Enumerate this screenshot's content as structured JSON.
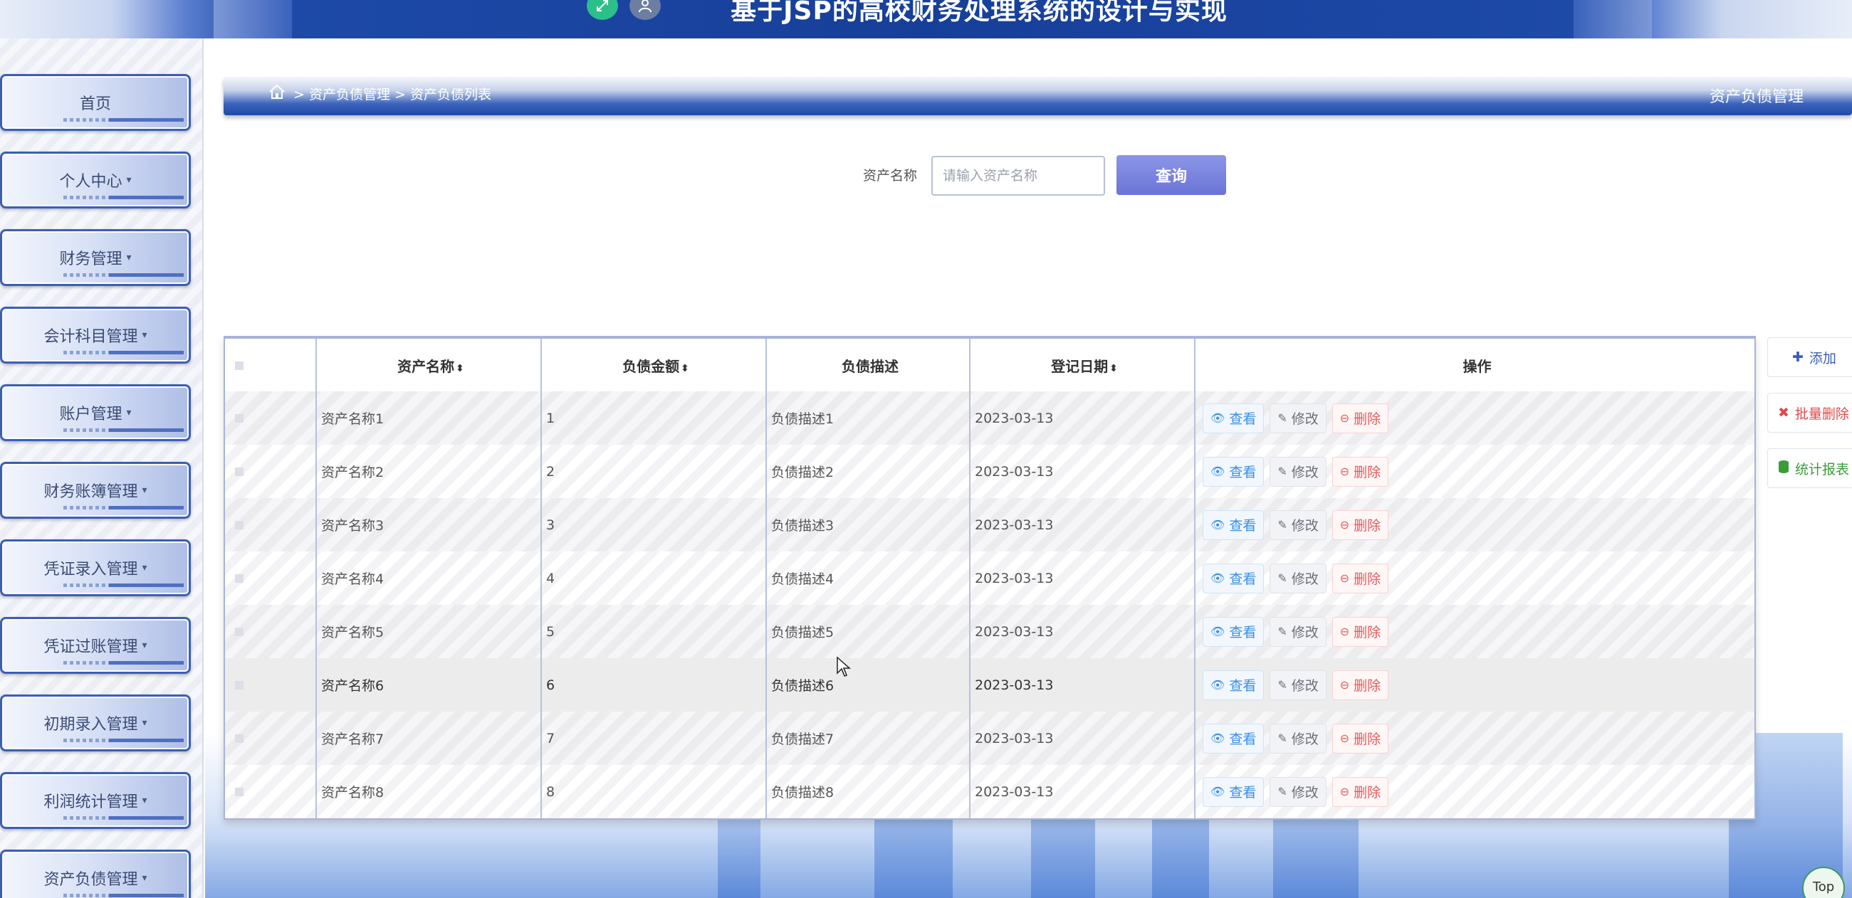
{
  "header": {
    "title": "基于JSP的高校财务处理系统的设计与实现"
  },
  "sidebar": {
    "items": [
      {
        "label": "首页",
        "has_caret": false
      },
      {
        "label": "个人中心",
        "has_caret": true
      },
      {
        "label": "财务管理",
        "has_caret": true
      },
      {
        "label": "会计科目管理",
        "has_caret": true
      },
      {
        "label": "账户管理",
        "has_caret": true
      },
      {
        "label": "财务账簿管理",
        "has_caret": true
      },
      {
        "label": "凭证录入管理",
        "has_caret": true
      },
      {
        "label": "凭证过账管理",
        "has_caret": true
      },
      {
        "label": "初期录入管理",
        "has_caret": true
      },
      {
        "label": "利润统计管理",
        "has_caret": true
      },
      {
        "label": "资产负债管理",
        "has_caret": true
      }
    ]
  },
  "breadcrumb": {
    "separator": ">",
    "level1": "资产负债管理",
    "level2": "资产负债列表",
    "right_title": "资产负债管理"
  },
  "search": {
    "label": "资产名称",
    "placeholder": "请输入资产名称",
    "value": "",
    "button_label": "查询"
  },
  "table": {
    "columns": [
      "资产名称",
      "负债金额",
      "负债描述",
      "登记日期",
      "操作"
    ],
    "sort_icon": "sort-icon",
    "rows": [
      {
        "name": "资产名称1",
        "amount": "1",
        "desc": "负债描述1",
        "date": "2023-03-13"
      },
      {
        "name": "资产名称2",
        "amount": "2",
        "desc": "负债描述2",
        "date": "2023-03-13"
      },
      {
        "name": "资产名称3",
        "amount": "3",
        "desc": "负债描述3",
        "date": "2023-03-13"
      },
      {
        "name": "资产名称4",
        "amount": "4",
        "desc": "负债描述4",
        "date": "2023-03-13"
      },
      {
        "name": "资产名称5",
        "amount": "5",
        "desc": "负债描述5",
        "date": "2023-03-13"
      },
      {
        "name": "资产名称6",
        "amount": "6",
        "desc": "负债描述6",
        "date": "2023-03-13"
      },
      {
        "name": "资产名称7",
        "amount": "7",
        "desc": "负债描述7",
        "date": "2023-03-13"
      },
      {
        "name": "资产名称8",
        "amount": "8",
        "desc": "负债描述8",
        "date": "2023-03-13"
      }
    ],
    "actions": {
      "view": "查看",
      "edit": "修改",
      "delete": "删除"
    }
  },
  "side_actions": {
    "add": "添加",
    "batch_delete": "批量删除",
    "report": "统计报表"
  },
  "top_button": "Top",
  "colors": {
    "brand": "#1e4aa8",
    "search_button": "#6a74d6",
    "view": "#3a8ee6",
    "delete": "#e65a5a",
    "report": "#3b9b3b"
  }
}
